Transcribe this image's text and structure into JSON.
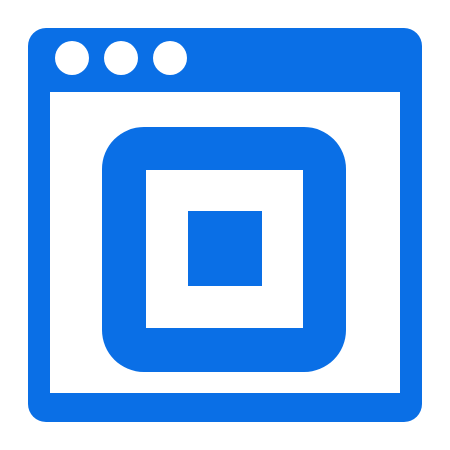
{
  "icon": {
    "name": "browser-window-with-square-logo-icon",
    "colors": {
      "primary": "#0A6FE6",
      "background": "#FFFFFF"
    },
    "window_controls": [
      "window-control-dot-1",
      "window-control-dot-2",
      "window-control-dot-3"
    ]
  }
}
